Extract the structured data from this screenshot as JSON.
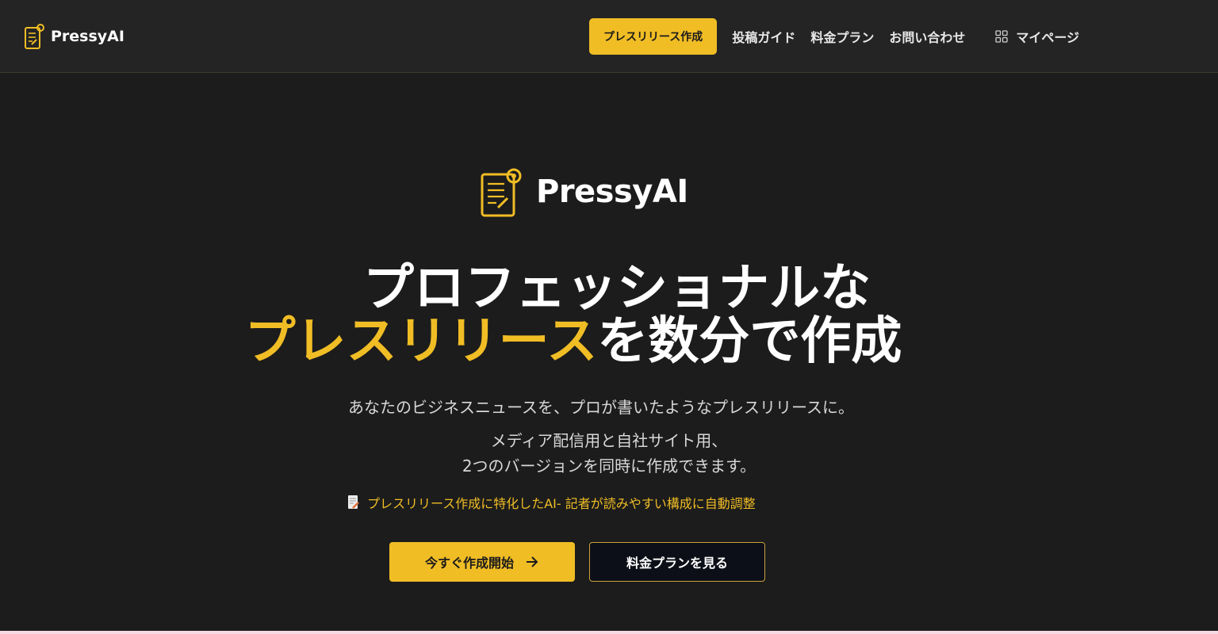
{
  "header": {
    "brand": "PressyAI",
    "nav_cta": "プレスリリース作成",
    "nav_guide": "投稿ガイド",
    "nav_pricing": "料金プラン",
    "nav_contact": "お問い合わせ",
    "nav_mypage": "マイページ"
  },
  "hero": {
    "brand": "PressyAI",
    "headline_line1": "プロフェッショナルな",
    "headline_accent": "プレスリリース",
    "headline_rest": "を数分で作成",
    "sub1": "あなたのビジネスニュースを、プロが書いたようなプレスリリースに。",
    "sub2": "メディア配信用と自社サイト用、",
    "sub3": "2つのバージョンを同時に作成できます。",
    "feature": "プレスリリース作成に特化したAI- 記者が読みやすい構成に自動調整",
    "cta_primary": "今すぐ作成開始",
    "cta_secondary": "料金プランを見る"
  },
  "colors": {
    "accent": "#f0bd25",
    "background": "#1c1c1c",
    "header_bg": "#242424"
  },
  "icons": {
    "logo": "document-pencil-icon",
    "mypage": "grid-icon",
    "feature": "memo-icon",
    "cta_arrow": "arrow-right-icon"
  }
}
